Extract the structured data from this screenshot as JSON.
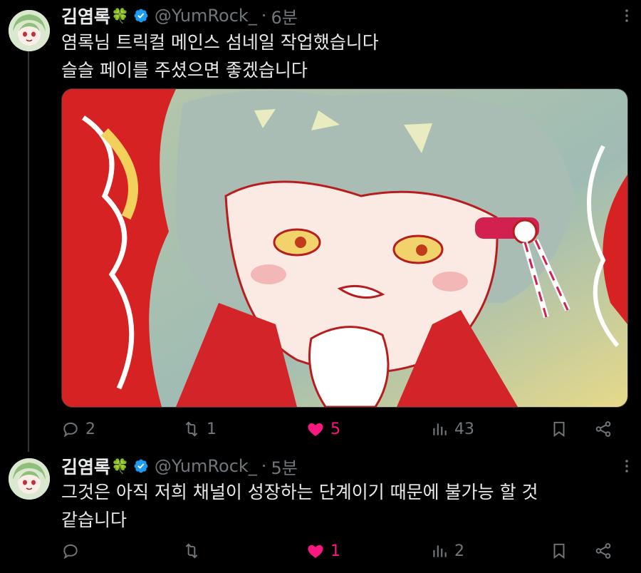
{
  "tweets": [
    {
      "author_name": "김염록",
      "name_emoji": "🍀",
      "handle": "@YumRock_",
      "separator": "·",
      "time": "6분",
      "text_lines": [
        "염록님 트릭컬 메인스 섬네일 작업했습니다",
        "슬슬 페이를 주셨으면 좋겠습니다"
      ],
      "replies": "2",
      "retweets": "1",
      "likes": "5",
      "views": "43",
      "liked": true
    },
    {
      "author_name": "김염록",
      "name_emoji": "🍀",
      "handle": "@YumRock_",
      "separator": "·",
      "time": "5분",
      "text_lines": [
        "그것은 아직 저희 채널이 성장하는 단계이기 때문에 불가능 할 것",
        "같습니다"
      ],
      "replies": "",
      "retweets": "",
      "likes": "1",
      "views": "2",
      "liked": true
    }
  ],
  "colors": {
    "background": "#000000",
    "text": "#e7e9ea",
    "muted": "#71767b",
    "like": "#f91880",
    "verified": "#1d9bf0"
  },
  "icons": [
    "reply-icon",
    "retweet-icon",
    "heart-icon",
    "views-icon",
    "bookmark-icon",
    "share-icon",
    "verified-badge-icon",
    "more-icon"
  ]
}
